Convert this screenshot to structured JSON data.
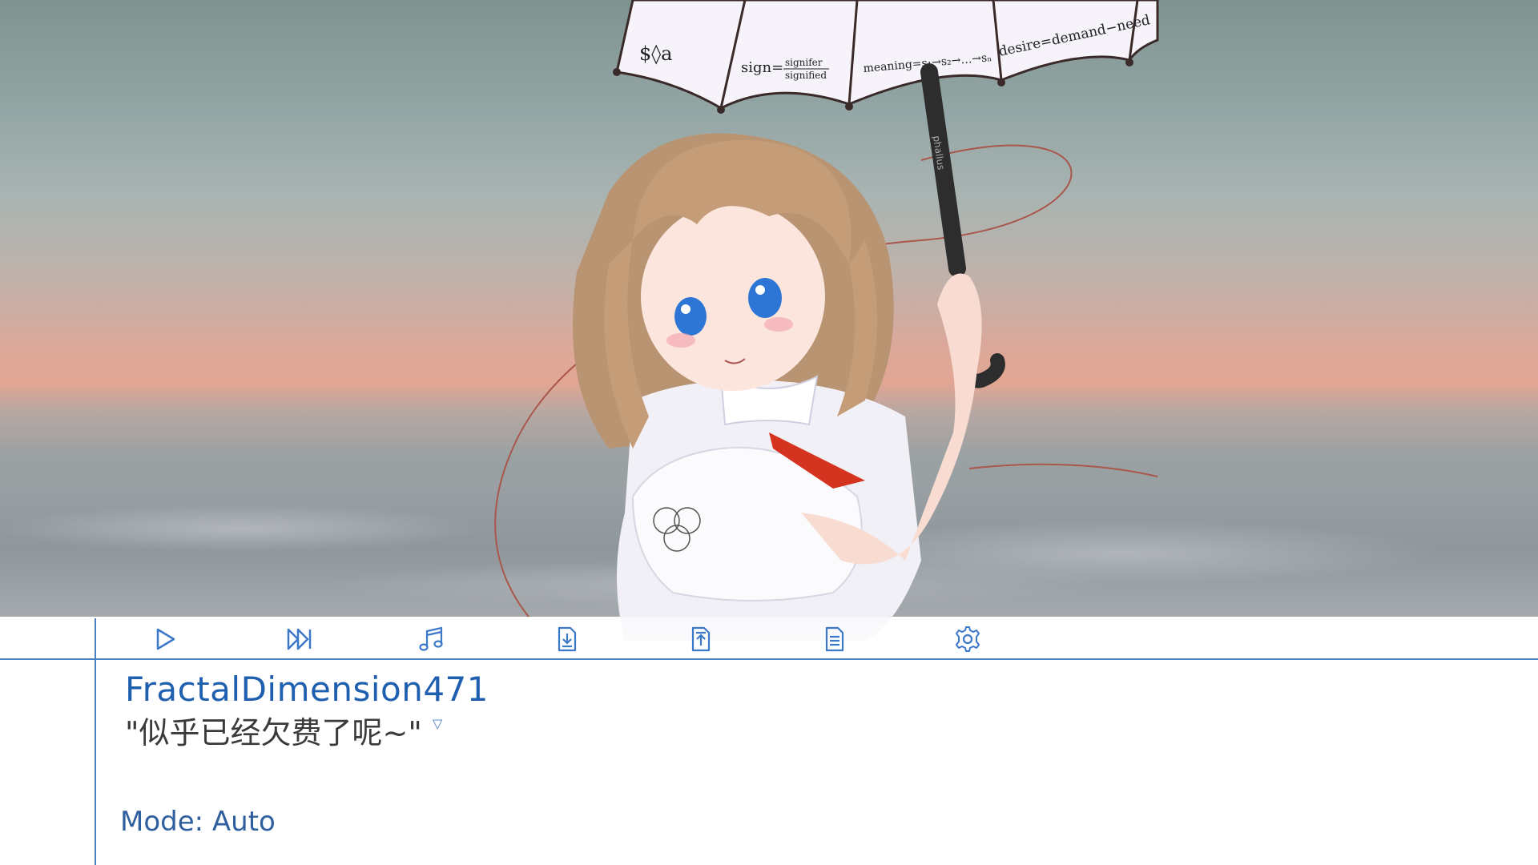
{
  "toolbar": {
    "buttons": [
      {
        "name": "play",
        "icon": "play-icon"
      },
      {
        "name": "skip",
        "icon": "fast-forward-icon"
      },
      {
        "name": "music",
        "icon": "music-note-icon"
      },
      {
        "name": "save",
        "icon": "save-download-icon"
      },
      {
        "name": "load",
        "icon": "load-upload-icon"
      },
      {
        "name": "log",
        "icon": "document-log-icon"
      },
      {
        "name": "settings",
        "icon": "gear-icon"
      }
    ],
    "accent": "#4a7fc3"
  },
  "umbrella": {
    "writing": [
      "$◊a",
      "sign=",
      "signifer",
      "signified",
      "meaning=s₁→s₂→…→sₙ",
      "desire=demand−need"
    ],
    "handle_text": "phallus"
  },
  "dialogue": {
    "speaker": "FractalDimension471",
    "text": "\"似乎已经欠费了呢~\"",
    "advance_marker": "▽",
    "speaker_color": "#1f5fb0"
  },
  "status": {
    "mode": "Mode: Auto"
  }
}
